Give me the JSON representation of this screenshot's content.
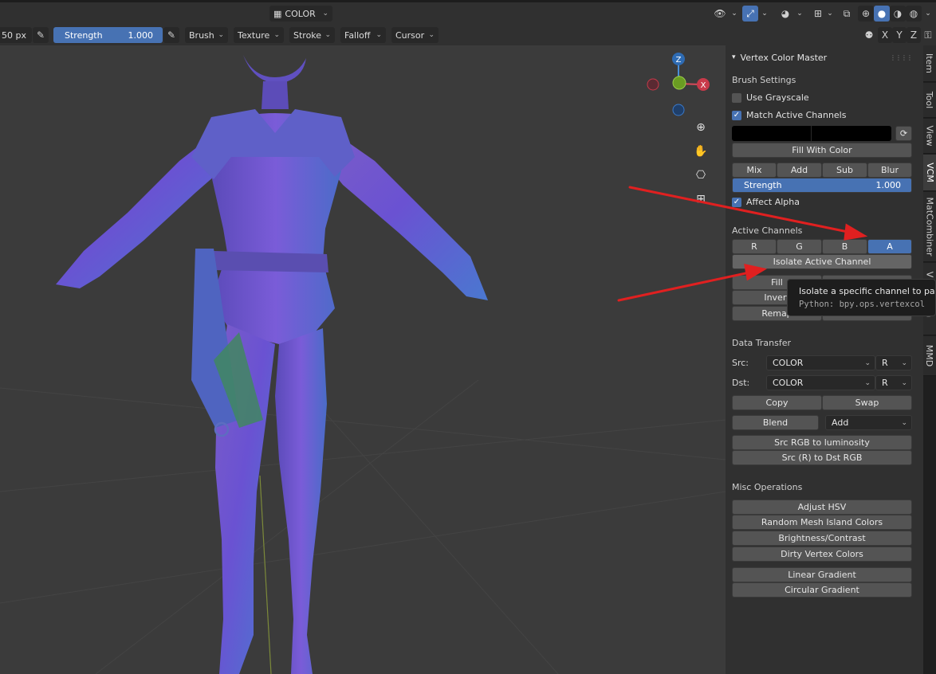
{
  "header": {
    "mode_label": "COLOR"
  },
  "toolbar": {
    "radius_value": "50 px",
    "strength_label": "Strength",
    "strength_value": "1.000",
    "menus": [
      "Brush",
      "Texture",
      "Stroke",
      "Falloff",
      "Cursor"
    ],
    "symmetry_axes": [
      "X",
      "Y",
      "Z"
    ]
  },
  "gizmo": {
    "z_label": "Z",
    "x_label": "X"
  },
  "panel": {
    "title": "Vertex Color Master",
    "brush_settings": {
      "heading": "Brush Settings",
      "use_grayscale": "Use Grayscale",
      "match_active_channels": "Match Active Channels",
      "fill_with_color": "Fill With Color",
      "blend_modes": [
        "Mix",
        "Add",
        "Sub",
        "Blur"
      ],
      "strength_label": "Strength",
      "strength_value": "1.000",
      "affect_alpha": "Affect Alpha"
    },
    "active_channels": {
      "heading": "Active Channels",
      "channels": [
        "R",
        "G",
        "B",
        "A"
      ],
      "active_channel": "A",
      "isolate": "Isolate Active Channel",
      "fill": "Fill",
      "invert": "Invert",
      "remap": "Remap"
    },
    "data_transfer": {
      "heading": "Data Transfer",
      "src_label": "Src:",
      "src_layer": "COLOR",
      "src_channel": "R",
      "dst_label": "Dst:",
      "dst_layer": "COLOR",
      "dst_channel": "R",
      "copy": "Copy",
      "swap": "Swap",
      "blend": "Blend",
      "blend_mode": "Add",
      "src_rgb_to_luminosity": "Src RGB to luminosity",
      "src_r_to_dst_rgb": "Src (R) to Dst RGB"
    },
    "misc": {
      "heading": "Misc Operations",
      "adjust_hsv": "Adjust HSV",
      "random_island": "Random Mesh Island Colors",
      "brightness_contrast": "Brightness/Contrast",
      "dirty_vertex": "Dirty Vertex Colors",
      "linear_gradient": "Linear Gradient",
      "circular_gradient": "Circular Gradient"
    }
  },
  "tooltip": {
    "text": "Isolate a specific channel to pain",
    "python": "Python: bpy.ops.vertexcol"
  },
  "side_tabs": [
    "Item",
    "Tool",
    "View",
    "VCM",
    "MatCombiner",
    "V",
    "rta",
    "MMD"
  ],
  "colors": {
    "accent": "#4772b3",
    "arrow": "#e02020"
  }
}
